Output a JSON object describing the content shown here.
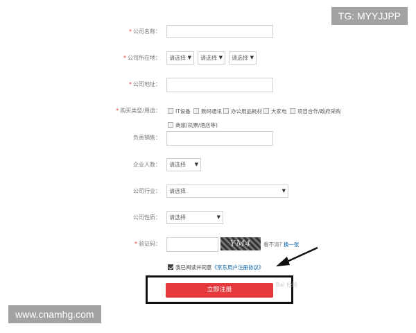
{
  "form": {
    "company_name": {
      "label": "公司名称："
    },
    "company_location": {
      "label": "公司所在地：",
      "selects": [
        "请选择",
        "请选择",
        "请选择"
      ]
    },
    "company_address": {
      "label": "公司地址："
    },
    "purchase_type": {
      "label": "购买类型/用途：",
      "options": [
        "IT设备",
        "数码通讯",
        "办公用品耗材",
        "大家电",
        "项目合作/政府采购",
        "商旅(机票/酒店等)"
      ]
    },
    "sales_rep": {
      "label": "负责销售："
    },
    "company_size": {
      "label": "企业人数：",
      "value": "请选择"
    },
    "industry": {
      "label": "公司行业：",
      "value": "请选择"
    },
    "nature": {
      "label": "公司性质：",
      "value": "请选择"
    },
    "captcha": {
      "label": "验证码：",
      "image_text": "YM4",
      "hint": "看不清?",
      "refresh_link": "换一张"
    },
    "agreement": {
      "prefix": "我已阅读并同意",
      "link": "《京东用户注册协议》",
      "checked": true
    },
    "submit_label": "立即注册"
  },
  "overlays": {
    "tg_label": "TG: MYYJJPP",
    "watermark": "www.cnamhg.com",
    "baidu_mark": "Bai 经验"
  },
  "colors": {
    "accent": "#e4393c",
    "link": "#005ea7"
  }
}
